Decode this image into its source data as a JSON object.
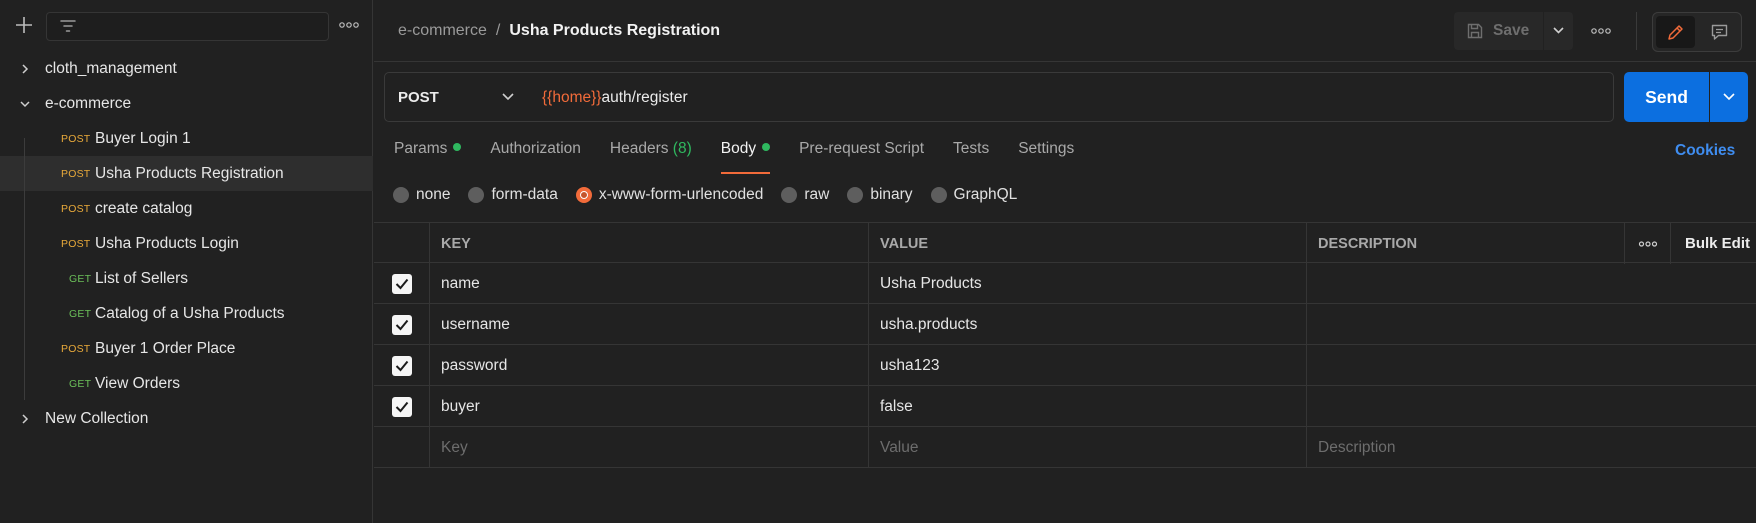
{
  "sidebar": {
    "collections": [
      {
        "name": "cloth_management",
        "expanded": false
      },
      {
        "name": "e-commerce",
        "expanded": true
      },
      {
        "name": "New Collection",
        "expanded": false
      }
    ],
    "requests": [
      {
        "method": "POST",
        "name": "Buyer Login 1"
      },
      {
        "method": "POST",
        "name": "Usha Products Registration",
        "selected": true
      },
      {
        "method": "POST",
        "name": "create catalog"
      },
      {
        "method": "POST",
        "name": "Usha Products Login"
      },
      {
        "method": "GET",
        "name": "List of Sellers"
      },
      {
        "method": "GET",
        "name": "Catalog of a Usha Products"
      },
      {
        "method": "POST",
        "name": "Buyer 1 Order Place"
      },
      {
        "method": "GET",
        "name": "View Orders"
      }
    ]
  },
  "header": {
    "breadcrumb_parent": "e-commerce",
    "breadcrumb_sep": "/",
    "breadcrumb_current": "Usha Products Registration",
    "save_label": "Save"
  },
  "request": {
    "method": "POST",
    "url_variable": "{{home}}",
    "url_path": "auth/register",
    "send_label": "Send"
  },
  "tabs": [
    {
      "label": "Params",
      "dot": true
    },
    {
      "label": "Authorization"
    },
    {
      "label": "Headers",
      "count": "(8)"
    },
    {
      "label": "Body",
      "dot": true,
      "active": true
    },
    {
      "label": "Pre-request Script"
    },
    {
      "label": "Tests"
    },
    {
      "label": "Settings"
    }
  ],
  "cookies_label": "Cookies",
  "body_types": [
    {
      "label": "none"
    },
    {
      "label": "form-data"
    },
    {
      "label": "x-www-form-urlencoded",
      "selected": true
    },
    {
      "label": "raw"
    },
    {
      "label": "binary"
    },
    {
      "label": "GraphQL"
    }
  ],
  "table": {
    "headers": {
      "key": "KEY",
      "value": "VALUE",
      "description": "DESCRIPTION",
      "bulk_edit": "Bulk Edit"
    },
    "rows": [
      {
        "checked": true,
        "key": "name",
        "value": "Usha Products",
        "description": ""
      },
      {
        "checked": true,
        "key": "username",
        "value": "usha.products",
        "description": ""
      },
      {
        "checked": true,
        "key": "password",
        "value": "usha123",
        "description": ""
      },
      {
        "checked": true,
        "key": "buyer",
        "value": "false",
        "description": ""
      }
    ],
    "placeholders": {
      "key": "Key",
      "value": "Value",
      "description": "Description"
    }
  },
  "colors": {
    "accent": "#f26b3a",
    "send_blue": "#0c6fe0",
    "post_method": "#e8a93a",
    "get_method": "#6bbf59",
    "status_green": "#2fb85f"
  }
}
